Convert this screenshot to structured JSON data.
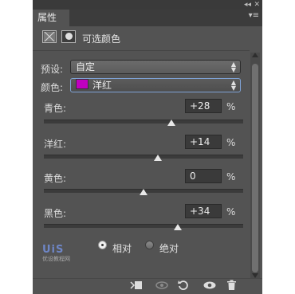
{
  "window": {
    "collapse_glyph": "◂◂",
    "close_glyph": "✕"
  },
  "tabs": {
    "active_label": "属性",
    "menu_glyph": "▾≡"
  },
  "header": {
    "title": "可选颜色",
    "adjustment_icon": "selective-color-icon",
    "mask_icon": "mask-icon"
  },
  "preset": {
    "label": "预设:",
    "value": "自定"
  },
  "colors": {
    "label": "颜色:",
    "value": "洋红",
    "swatch_color": "#c000c0"
  },
  "sliders": [
    {
      "label": "青色:",
      "value": "+28",
      "unit": "%",
      "level": 28
    },
    {
      "label": "洋红:",
      "value": "+14",
      "unit": "%",
      "level": 14
    },
    {
      "label": "黄色:",
      "value": "0",
      "unit": "%",
      "level": 0
    },
    {
      "label": "黑色:",
      "value": "+34",
      "unit": "%",
      "level": 34
    }
  ],
  "mode": {
    "relative_label": "相对",
    "absolute_label": "绝对",
    "selected": "relative"
  },
  "bottom_icons": [
    "clip-to-layer-icon",
    "view-previous-icon",
    "reset-icon",
    "visibility-icon",
    "trash-icon"
  ],
  "watermark": {
    "logo": "UiS",
    "sub": "优设教程网"
  }
}
